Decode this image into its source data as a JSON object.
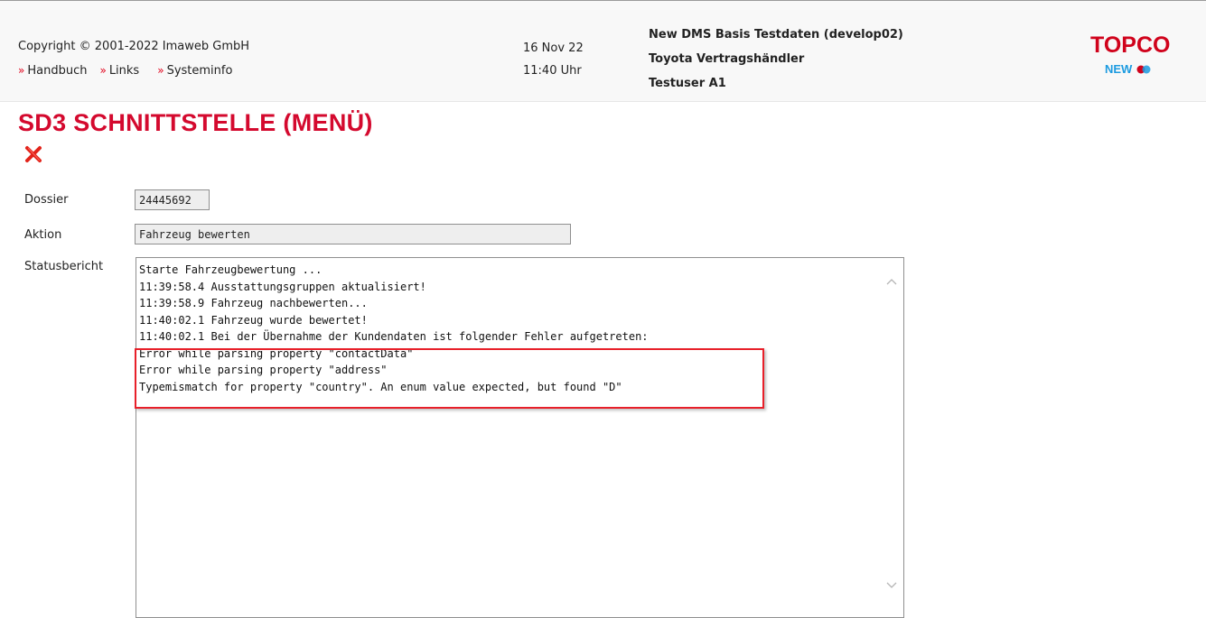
{
  "header": {
    "copyright": "Copyright © 2001-2022 Imaweb GmbH",
    "nav_links": [
      "Handbuch",
      "Links",
      "Systeminfo"
    ],
    "date": "16 Nov 22",
    "time": "11:40 Uhr",
    "context": {
      "database": "New DMS Basis Testdaten (develop02)",
      "dealer": "Toyota Vertragshändler",
      "user": "Testuser A1"
    },
    "logo": {
      "topco": "TOPCO",
      "new": "NEW"
    }
  },
  "page": {
    "title": "SD3 SCHNITTSTELLE (MENÜ)",
    "close_icon": "red-x-icon"
  },
  "form": {
    "dossier_label": "Dossier",
    "dossier_value": "24445692",
    "aktion_label": "Aktion",
    "aktion_value": "Fahrzeug bewerten",
    "status_label": "Statusbericht",
    "status_lines": [
      "Starte Fahrzeugbewertung ...",
      "11:39:58.4 Ausstattungsgruppen aktualisiert!",
      "11:39:58.9 Fahrzeug nachbewerten...",
      "11:40:02.1 Fahrzeug wurde bewertet!",
      "11:40:02.1 Bei der Übernahme der Kundendaten ist folgender Fehler aufgetreten:",
      "Error while parsing property \"contactData\"",
      "Error while parsing property \"address\"",
      "Typemismatch for property \"country\". An enum value expected, but found \"D\""
    ]
  },
  "colors": {
    "brand_red": "#d4092e",
    "highlight_red": "#e8202a",
    "logo_blue": "#1d9be0"
  }
}
